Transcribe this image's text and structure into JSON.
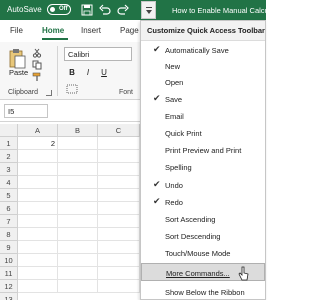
{
  "titlebar": {
    "autosave_label": "AutoSave",
    "autosave_state": "Off",
    "title": "How to Enable Manual Calcu"
  },
  "ribbon": {
    "tabs": [
      "File",
      "Home",
      "Insert",
      "Page"
    ],
    "active_tab": "Home",
    "paste_label": "Paste",
    "clipboard_label": "Clipboard",
    "font_name": "Calibri",
    "bold": "B",
    "italic": "I",
    "underline": "U",
    "font_group_label": "Font"
  },
  "formula_bar": {
    "name_box": "I5"
  },
  "grid": {
    "columns": [
      "A",
      "B",
      "C"
    ],
    "rows": [
      "1",
      "2",
      "3",
      "4",
      "5",
      "6",
      "7",
      "8",
      "9",
      "10",
      "11",
      "12",
      "13"
    ],
    "a1_value": "2"
  },
  "menu": {
    "title": "Customize Quick Access Toolbar",
    "items": [
      {
        "label": "Automatically Save",
        "checked": "✔"
      },
      {
        "label": "New",
        "checked": ""
      },
      {
        "label": "Open",
        "checked": ""
      },
      {
        "label": "Save",
        "checked": "✔"
      },
      {
        "label": "Email",
        "checked": ""
      },
      {
        "label": "Quick Print",
        "checked": ""
      },
      {
        "label": "Print Preview and Print",
        "checked": ""
      },
      {
        "label": "Spelling",
        "checked": ""
      },
      {
        "label": "Undo",
        "checked": "✔"
      },
      {
        "label": "Redo",
        "checked": "✔"
      },
      {
        "label": "Sort Ascending",
        "checked": ""
      },
      {
        "label": "Sort Descending",
        "checked": ""
      },
      {
        "label": "Touch/Mouse Mode",
        "checked": ""
      },
      {
        "label": "More Commands...",
        "checked": ""
      },
      {
        "label": "Show Below the Ribbon",
        "checked": ""
      }
    ]
  },
  "colors": {
    "excel_green": "#217346",
    "menu_hover": "#dcdcdc"
  }
}
